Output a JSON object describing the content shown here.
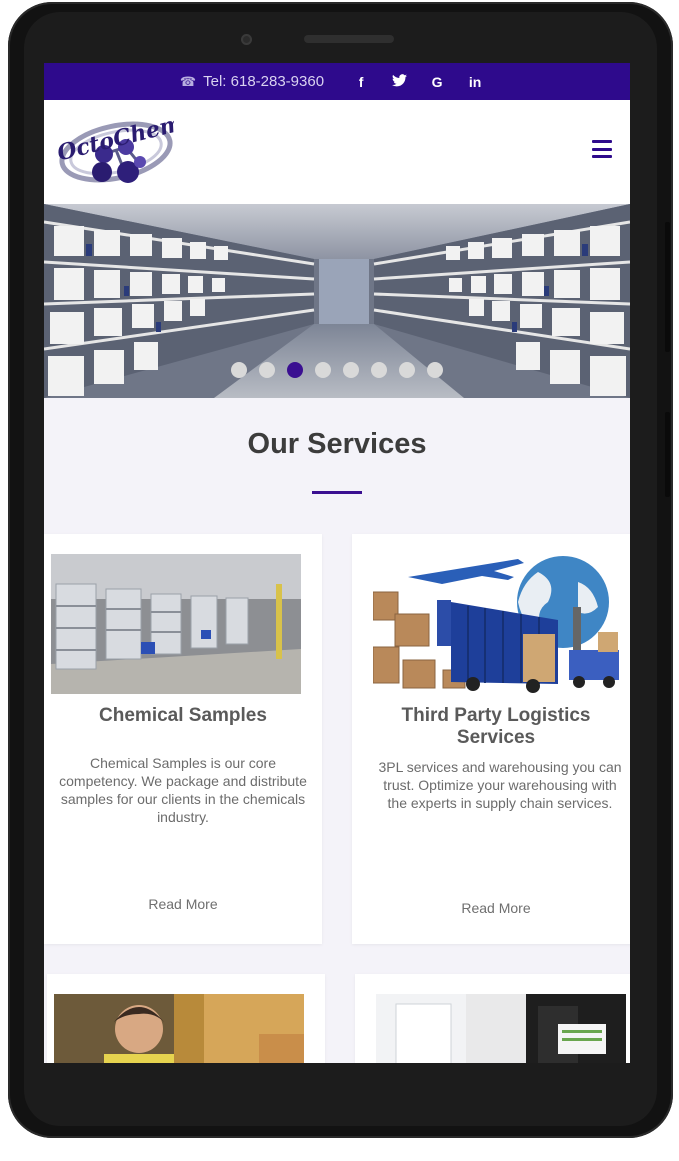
{
  "topbar": {
    "phone": "Tel: 618-283-9360",
    "social": [
      "f",
      "t",
      "G",
      "in"
    ]
  },
  "brand": {
    "logo_text": "OctoChem",
    "accent_color": "#2e0a8c"
  },
  "hero": {
    "slide_count": 8,
    "active_slide": 3
  },
  "services": {
    "title": "Our Services",
    "cards": [
      {
        "title": "Chemical Samples",
        "text": "Chemical Samples is our core competency. We package and distribute samples for our clients in the chemicals industry.",
        "link": "Read More"
      },
      {
        "title": "Third Party Logistics Services",
        "text": "3PL services and warehousing you can trust. Optimize your warehousing with the experts in supply chain services.",
        "link": "Read More"
      }
    ]
  }
}
